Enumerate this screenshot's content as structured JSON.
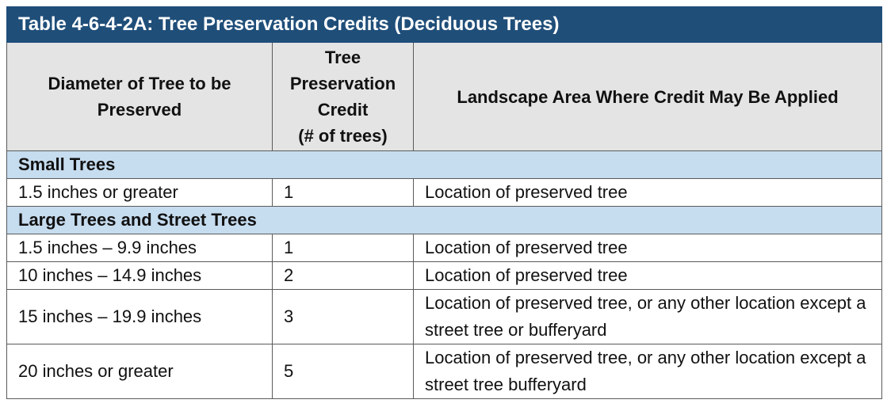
{
  "table": {
    "title": "Table 4-6-4-2A: Tree Preservation Credits (Deciduous Trees)",
    "headers": {
      "diameter": "Diameter of Tree to be Preserved",
      "credit_lines": [
        "Tree",
        "Preservation",
        "Credit",
        "(# of trees)"
      ],
      "area": "Landscape Area Where Credit May Be Applied"
    },
    "groups": [
      {
        "label": "Small Trees",
        "rows": [
          {
            "diameter": "1.5 inches or greater",
            "credit": "1",
            "area": "Location of preserved tree"
          }
        ]
      },
      {
        "label": "Large Trees and Street Trees",
        "rows": [
          {
            "diameter": "1.5 inches – 9.9 inches",
            "credit": "1",
            "area": "Location of preserved tree"
          },
          {
            "diameter": "10 inches – 14.9 inches",
            "credit": "2",
            "area": "Location of preserved tree"
          },
          {
            "diameter": "15 inches – 19.9 inches",
            "credit": "3",
            "area": "Location of preserved tree, or any other location except a street tree or bufferyard"
          },
          {
            "diameter": "20 inches or greater",
            "credit": "5",
            "area": "Location of preserved tree, or any other location except a street tree bufferyard"
          }
        ]
      }
    ],
    "colors": {
      "title_bg": "#1f4e79",
      "header_bg": "#e4e4e4",
      "group_bg": "#c6dcef"
    }
  }
}
